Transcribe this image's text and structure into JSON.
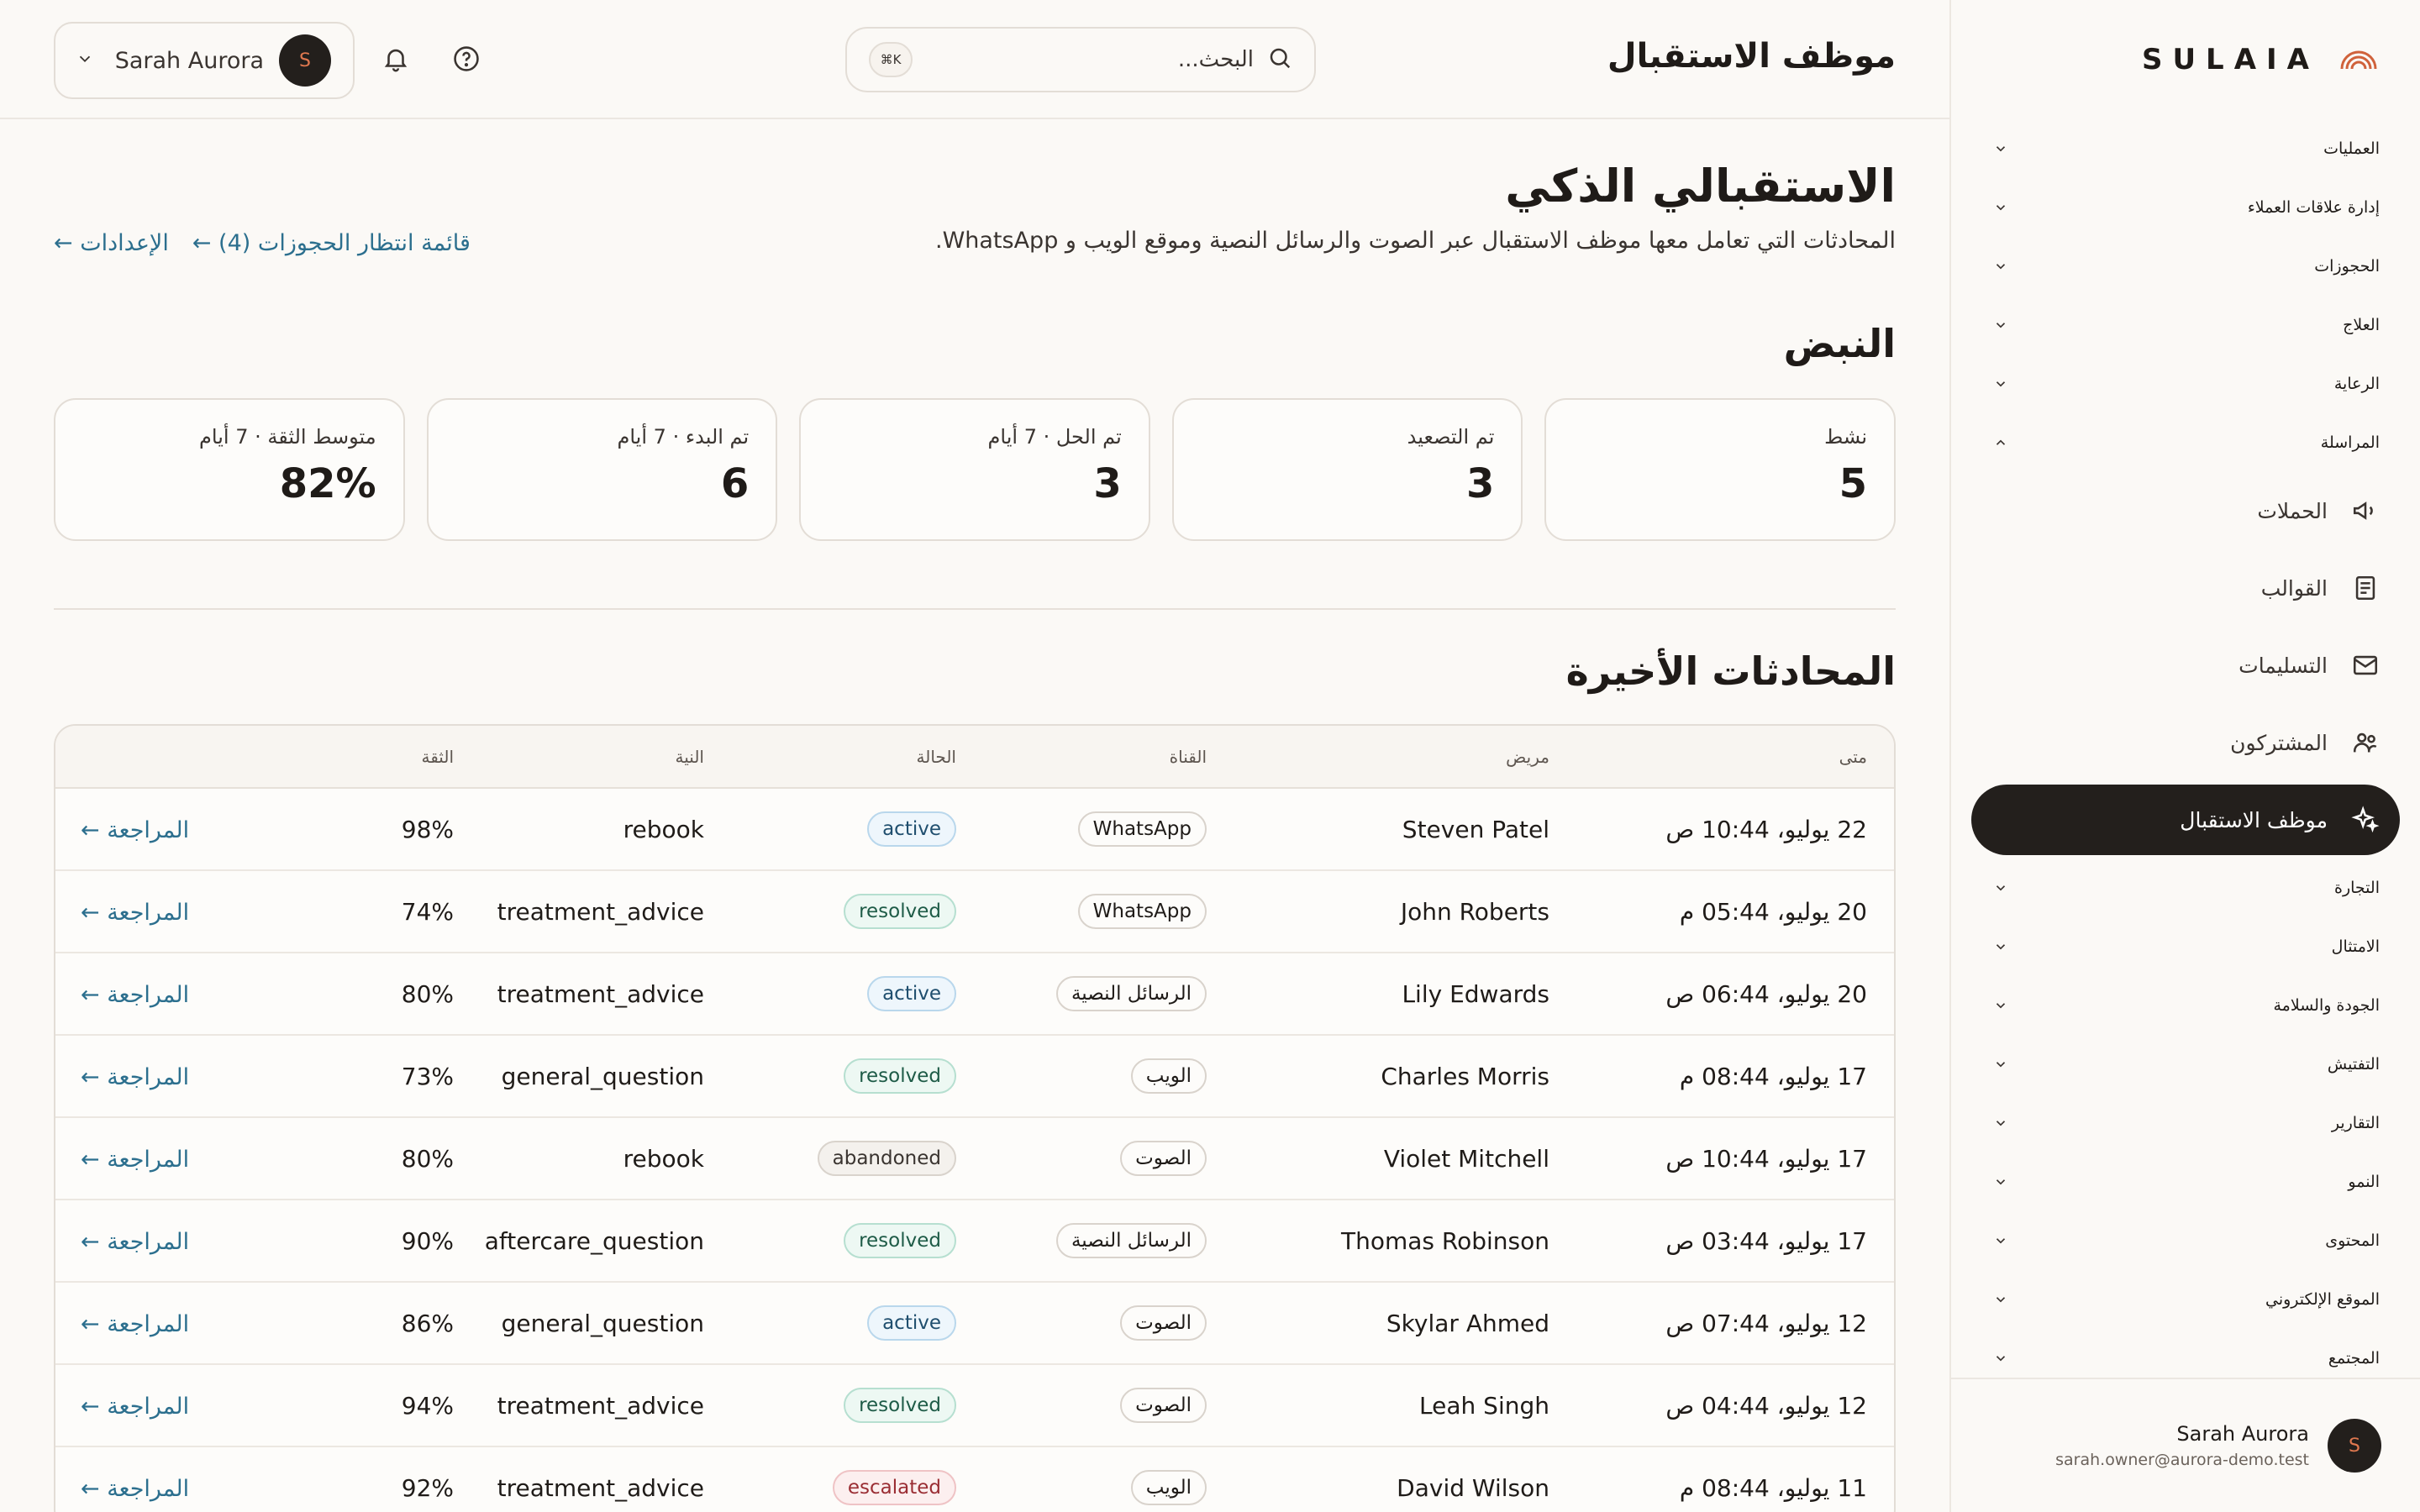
{
  "brand": {
    "name": "SULAIA"
  },
  "header": {
    "title": "موظف الاستقبال",
    "search_placeholder": "البحث...",
    "search_shortcut": "⌘K",
    "user_name": "Sarah Aurora",
    "user_initial": "S"
  },
  "sidebar": {
    "sections_top": [
      {
        "label": "العمليات",
        "expanded": false
      },
      {
        "label": "إدارة علاقات العملاء",
        "expanded": false
      },
      {
        "label": "الحجوزات",
        "expanded": false
      },
      {
        "label": "العلاج",
        "expanded": false
      },
      {
        "label": "الرعاية",
        "expanded": false
      },
      {
        "label": "المراسلة",
        "expanded": true
      }
    ],
    "messaging_items": [
      {
        "label": "الحملات",
        "icon": "megaphone-icon"
      },
      {
        "label": "القوالب",
        "icon": "template-icon"
      },
      {
        "label": "التسليمات",
        "icon": "mail-icon"
      },
      {
        "label": "المشتركون",
        "icon": "users-icon"
      },
      {
        "label": "موظف الاستقبال",
        "icon": "sparkles-icon",
        "active": true
      }
    ],
    "sections_bottom": [
      {
        "label": "التجارة"
      },
      {
        "label": "الامتثال"
      },
      {
        "label": "الجودة والسلامة"
      },
      {
        "label": "التفتيش"
      },
      {
        "label": "التقارير"
      },
      {
        "label": "النمو"
      },
      {
        "label": "المحتوى"
      },
      {
        "label": "الموقع الإلكتروني"
      },
      {
        "label": "المجتمع"
      }
    ],
    "footer": {
      "name": "Sarah Aurora",
      "email": "sarah.owner@aurora-demo.test",
      "initial": "S"
    }
  },
  "page": {
    "title": "الاستقبالي الذكي",
    "subtitle": "المحادثات التي تعامل معها موظف الاستقبال عبر الصوت والرسائل النصية وموقع الويب و WhatsApp.",
    "links": {
      "waitlist": "قائمة انتظار الحجوزات (4) ←",
      "settings": "الإعدادات ←"
    }
  },
  "pulse": {
    "title": "النبض",
    "stats": [
      {
        "label": "نشط",
        "value": "5"
      },
      {
        "label": "تم التصعيد",
        "value": "3"
      },
      {
        "label": "تم الحل · 7 أيام",
        "value": "3"
      },
      {
        "label": "تم البدء · 7 أيام",
        "value": "6"
      },
      {
        "label": "متوسط الثقة · 7 أيام",
        "value": "82%"
      }
    ]
  },
  "recent": {
    "title": "المحادثات الأخيرة",
    "columns": [
      "متى",
      "مريض",
      "القناة",
      "الحالة",
      "النية",
      "الثقة",
      ""
    ],
    "review_label": "المراجعة ←",
    "rows": [
      {
        "when": "22 يوليو، 10:44 ص",
        "patient": "Steven Patel",
        "channel": "WhatsApp",
        "status": "active",
        "intent": "rebook",
        "confidence": "98%"
      },
      {
        "when": "20 يوليو، 05:44 م",
        "patient": "John Roberts",
        "channel": "WhatsApp",
        "status": "resolved",
        "intent": "treatment_advice",
        "confidence": "74%"
      },
      {
        "when": "20 يوليو، 06:44 ص",
        "patient": "Lily Edwards",
        "channel": "الرسائل النصية",
        "status": "active",
        "intent": "treatment_advice",
        "confidence": "80%"
      },
      {
        "when": "17 يوليو، 08:44 م",
        "patient": "Charles Morris",
        "channel": "الويب",
        "status": "resolved",
        "intent": "general_question",
        "confidence": "73%"
      },
      {
        "when": "17 يوليو، 10:44 ص",
        "patient": "Violet Mitchell",
        "channel": "الصوت",
        "status": "abandoned",
        "intent": "rebook",
        "confidence": "80%"
      },
      {
        "when": "17 يوليو، 03:44 ص",
        "patient": "Thomas Robinson",
        "channel": "الرسائل النصية",
        "status": "resolved",
        "intent": "aftercare_question",
        "confidence": "90%"
      },
      {
        "when": "12 يوليو، 07:44 ص",
        "patient": "Skylar Ahmed",
        "channel": "الصوت",
        "status": "active",
        "intent": "general_question",
        "confidence": "86%"
      },
      {
        "when": "12 يوليو، 04:44 ص",
        "patient": "Leah Singh",
        "channel": "الصوت",
        "status": "resolved",
        "intent": "treatment_advice",
        "confidence": "94%"
      },
      {
        "when": "11 يوليو، 08:44 م",
        "patient": "David Wilson",
        "channel": "الويب",
        "status": "escalated",
        "intent": "treatment_advice",
        "confidence": "92%"
      }
    ]
  }
}
